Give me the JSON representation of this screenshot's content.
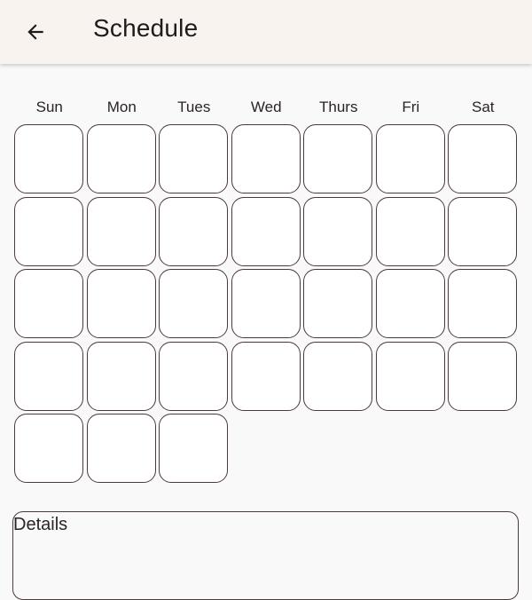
{
  "app_bar": {
    "title": "Schedule",
    "back_icon": "arrow-back-icon"
  },
  "calendar": {
    "weekdays": [
      "Sun",
      "Mon",
      "Tues",
      "Wed",
      "Thurs",
      "Fri",
      "Sat"
    ],
    "cell_count": 31
  },
  "details": {
    "label": "Details"
  },
  "colors": {
    "app_bar_bg": "#f8f3ef",
    "page_bg": "#faf9f9",
    "cell_border": "#4b3a3a",
    "text": "#1f1b1b"
  }
}
